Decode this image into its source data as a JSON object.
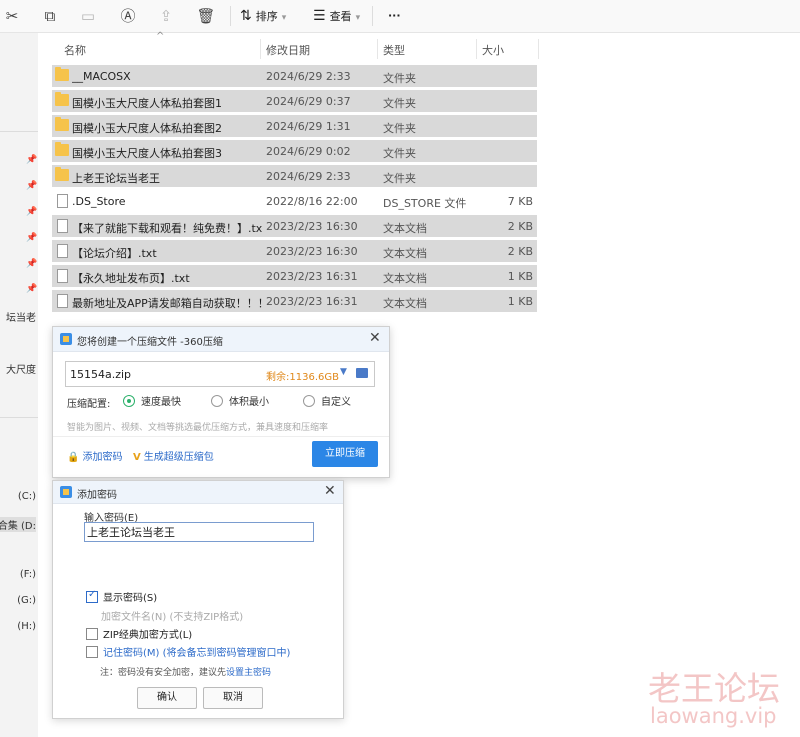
{
  "toolbar": {
    "icons": [
      "cut-icon",
      "copy-icon",
      "paste-icon",
      "rename-icon",
      "share-icon",
      "delete-icon"
    ],
    "sort_label": "排序",
    "view_label": "查看",
    "more_label": "···"
  },
  "sidebar": {
    "items": [
      {
        "label": "坛当老"
      },
      {
        "label": "大尺度"
      },
      {
        "label": "(C:)"
      },
      {
        "label": "合集 (D:"
      },
      {
        "label": "(F:)"
      },
      {
        "label": "(G:)"
      },
      {
        "label": "(H:)"
      }
    ]
  },
  "columns": {
    "name": "名称",
    "modified": "修改日期",
    "type": "类型",
    "size": "大小"
  },
  "files": [
    {
      "name": "__MACOSX",
      "date": "2024/6/29 2:33",
      "type": "文件夹",
      "size": "",
      "kind": "folder"
    },
    {
      "name": "国模小玉大尺度人体私拍套图1",
      "date": "2024/6/29 0:37",
      "type": "文件夹",
      "size": "",
      "kind": "folder"
    },
    {
      "name": "国模小玉大尺度人体私拍套图2",
      "date": "2024/6/29 1:31",
      "type": "文件夹",
      "size": "",
      "kind": "folder"
    },
    {
      "name": "国模小玉大尺度人体私拍套图3",
      "date": "2024/6/29 0:02",
      "type": "文件夹",
      "size": "",
      "kind": "folder"
    },
    {
      "name": "上老王论坛当老王",
      "date": "2024/6/29 2:33",
      "type": "文件夹",
      "size": "",
      "kind": "folder"
    },
    {
      "name": ".DS_Store",
      "date": "2022/8/16 22:00",
      "type": "DS_STORE 文件",
      "size": "7 KB",
      "kind": "file"
    },
    {
      "name": "【来了就能下载和观看！纯免费！】.txt",
      "date": "2023/2/23 16:30",
      "type": "文本文档",
      "size": "2 KB",
      "kind": "file"
    },
    {
      "name": "【论坛介绍】.txt",
      "date": "2023/2/23 16:30",
      "type": "文本文档",
      "size": "2 KB",
      "kind": "file"
    },
    {
      "name": "【永久地址发布页】.txt",
      "date": "2023/2/23 16:31",
      "type": "文本文档",
      "size": "1 KB",
      "kind": "file"
    },
    {
      "name": "最新地址及APP请发邮箱自动获取！！！....",
      "date": "2023/2/23 16:31",
      "type": "文本文档",
      "size": "1 KB",
      "kind": "file"
    }
  ],
  "compress_dialog": {
    "title": "您将创建一个压缩文件 -360压缩",
    "filename": "15154a.zip",
    "free_space": "剩余:1136.6GB",
    "config_label": "压缩配置:",
    "options": [
      "速度最快",
      "体积最小",
      "自定义"
    ],
    "selected_option": "速度最快",
    "hint": "智能为图片、视频、文档等挑选最优压缩方式，兼具速度和压缩率",
    "add_password": "添加密码",
    "super_archive": "生成超级压缩包",
    "compress_now": "立即压缩"
  },
  "password_dialog": {
    "title": "添加密码",
    "input_label": "输入密码(E)",
    "password_value": "上老王论坛当老王",
    "show_password": "显示密码(S)",
    "show_password_checked": true,
    "encrypt_names": "加密文件名(N) (不支持ZIP格式)",
    "zip_classic": "ZIP经典加密方式(L)",
    "remember": "记住密码(M) (将会备忘到密码管理窗口中)",
    "note_prefix": "注：密码没有安全加密，建议先",
    "note_link": "设置主密码",
    "ok": "确认",
    "cancel": "取消"
  },
  "watermark": {
    "line1": "老王论坛",
    "line2": "laowang.vip"
  }
}
